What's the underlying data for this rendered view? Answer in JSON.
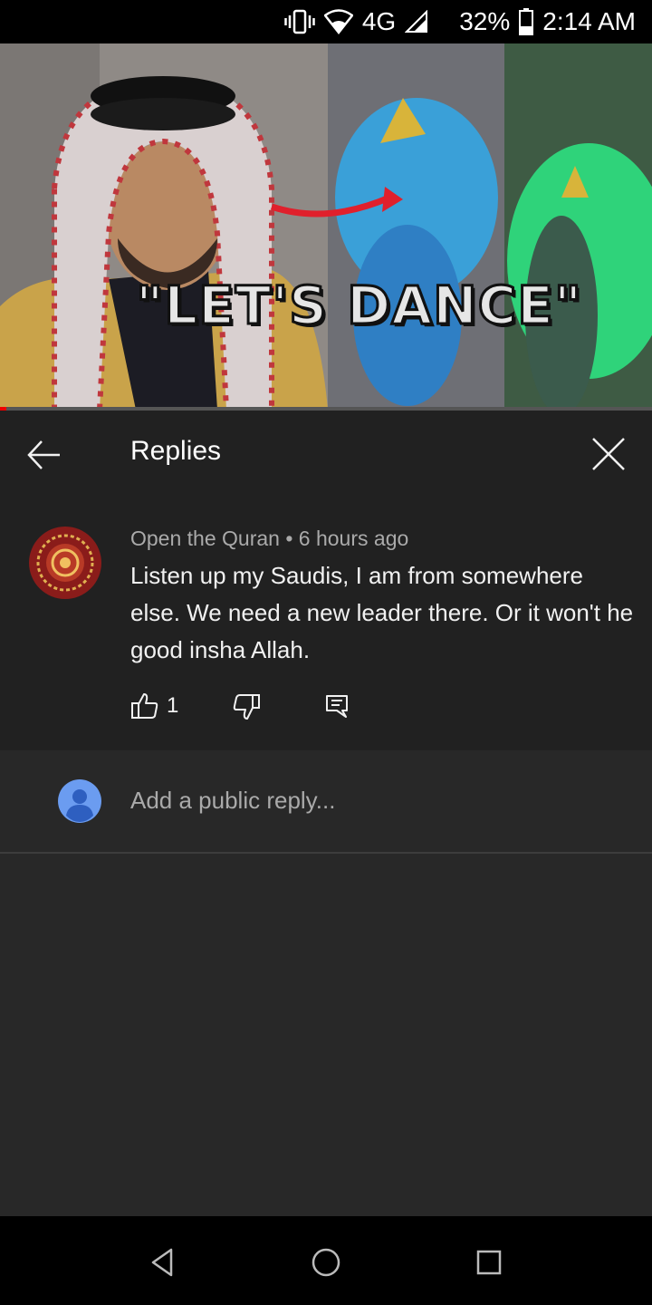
{
  "status_bar": {
    "network": "4G",
    "battery": "32%",
    "time": "2:14 AM",
    "icons": [
      "vibrate-icon",
      "wifi-icon",
      "signal-icon",
      "battery-icon"
    ]
  },
  "video": {
    "thumbnail_text": "\"LET'S DANCE\"",
    "progress": 0.01,
    "progress_color": "#ee0000"
  },
  "header": {
    "title": "Replies",
    "back_icon": "arrow-left-icon",
    "close_icon": "close-icon"
  },
  "comment": {
    "author": "Open the Quran",
    "separator": "•",
    "time": "6 hours ago",
    "text": "Listen up my Saudis, I am from somewhere else. We need a new leader there. Or it won't he good insha Allah.",
    "likes": "1"
  },
  "reply_box": {
    "placeholder": "Add a public reply..."
  },
  "colors": {
    "background": "#282828",
    "panel": "#212121",
    "secondary_text": "#aaaaaa",
    "user_avatar": "#6b9cf0"
  }
}
